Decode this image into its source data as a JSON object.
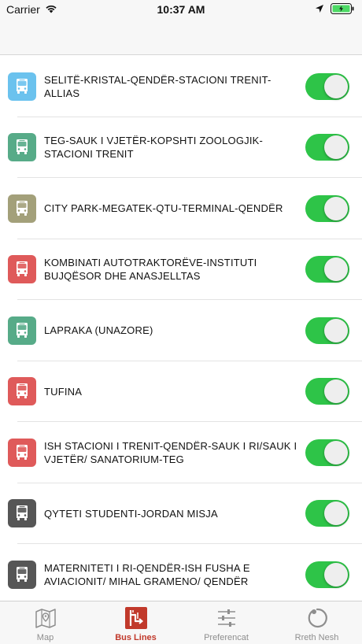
{
  "status_bar": {
    "carrier": "Carrier",
    "time": "10:37 AM",
    "wifi_icon": "wifi-icon",
    "location_icon": "location-arrow-icon",
    "battery_icon": "battery-icon",
    "battery_color": "#4cd964"
  },
  "bus_lines": [
    {
      "name": "SELITË-KRISTAL-QENDËR-STACIONI TRENIT-ALLIAS",
      "color": "#6bc2ee",
      "enabled": true
    },
    {
      "name": "TEG-SAUK I VJETËR-KOPSHTI ZOOLOGJIK-STACIONI TRENIT",
      "color": "#57ab88",
      "enabled": true
    },
    {
      "name": "CITY PARK-MEGATEK-QTU-TERMINAL-QENDËR",
      "color": "#a3a07a",
      "enabled": true
    },
    {
      "name": "KOMBINATI AUTOTRAKTORËVE-INSTITUTI BUJQËSOR DHE ANASJELLTAS",
      "color": "#df5a5a",
      "enabled": true
    },
    {
      "name": "LAPRAKA (UNAZORE)",
      "color": "#57ab88",
      "enabled": true
    },
    {
      "name": "TUFINA",
      "color": "#df5a5a",
      "enabled": true
    },
    {
      "name": "ISH STACIONI I TRENIT-QENDËR-SAUK I RI/SAUK I VJETËR/ SANATORIUM-TEG",
      "color": "#df5a5a",
      "enabled": true
    },
    {
      "name": "QYTETI STUDENTI-JORDAN MISJA",
      "color": "#565656",
      "enabled": true
    },
    {
      "name": "MATERNITETI I RI-QENDËR-ISH FUSHA E AVIACIONIT/ MIHAL GRAMENO/ QENDËR",
      "color": "#565656",
      "enabled": true
    }
  ],
  "colors": {
    "toggle_on": "#2ec448",
    "tab_active": "#c1392b",
    "tab_inactive": "#8e8e8e"
  },
  "tab_bar": {
    "tabs": [
      {
        "label": "Map",
        "icon": "map-icon",
        "active": false
      },
      {
        "label": "Bus Lines",
        "icon": "bus-lines-icon",
        "active": true
      },
      {
        "label": "Preferencat",
        "icon": "sliders-icon",
        "active": false
      },
      {
        "label": "Rreth Nesh",
        "icon": "about-icon",
        "active": false
      }
    ]
  }
}
